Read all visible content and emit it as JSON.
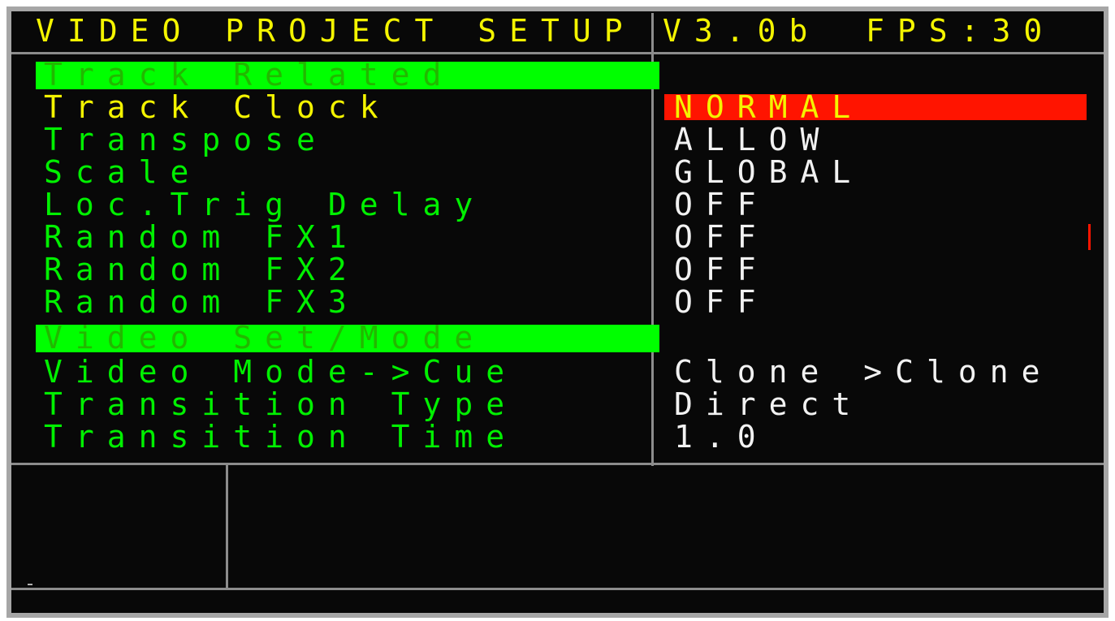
{
  "header": {
    "title": "VIDEO PROJECT SETUP",
    "version": "V3.0b",
    "fps": "FPS:30"
  },
  "sections": [
    {
      "title": "Track Related",
      "rows": [
        {
          "label": "Track Clock",
          "value": "NORMAL",
          "label_color": "yellow",
          "selected": true
        },
        {
          "label": "Transpose",
          "value": "ALLOW",
          "label_color": "green"
        },
        {
          "label": "Scale",
          "value": "GLOBAL",
          "label_color": "green"
        },
        {
          "label": "Loc.Trig Delay",
          "value": "OFF",
          "label_color": "green"
        },
        {
          "label": "Random FX1",
          "value": "OFF",
          "label_color": "green"
        },
        {
          "label": "Random FX2",
          "value": "OFF",
          "label_color": "green"
        },
        {
          "label": "Random FX3",
          "value": "OFF",
          "label_color": "green"
        }
      ]
    },
    {
      "title": "Video Set/Mode",
      "rows": [
        {
          "label": "Video Mode->Cue",
          "value": "Clone >Clone",
          "label_color": "green"
        },
        {
          "label": "Transition Type",
          "value": "Direct",
          "label_color": "green"
        },
        {
          "label": "Transition Time",
          "value": "1.0",
          "label_color": "green"
        }
      ]
    }
  ],
  "colors": {
    "background": "#080808",
    "frame": "#a6a6a6",
    "title_text": "#f4f400",
    "label_text": "#00f000",
    "value_text": "#f2f2f2",
    "section_highlight": "#00ff00",
    "selection_highlight": "#ff1400",
    "divider": "#8c8c8c"
  }
}
